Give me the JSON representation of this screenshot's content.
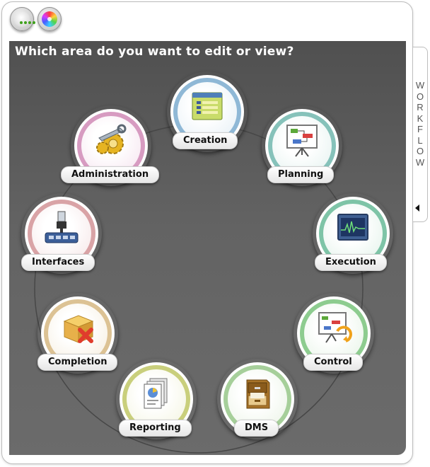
{
  "toolbar": {
    "buttons": [
      {
        "name": "more-options-button",
        "icon": "dots-icon"
      },
      {
        "name": "color-theme-button",
        "icon": "color-wheel-icon"
      }
    ]
  },
  "panel": {
    "heading": "Which area do you want to edit or view?"
  },
  "areas": [
    {
      "label": "Creation",
      "icon": "form-document-icon",
      "color": "#8fb8d6"
    },
    {
      "label": "Planning",
      "icon": "flowchart-board-icon",
      "color": "#86c2ba"
    },
    {
      "label": "Execution",
      "icon": "waveform-monitor-icon",
      "color": "#7ec4a7"
    },
    {
      "label": "Control",
      "icon": "board-refresh-icon",
      "color": "#8dcc8f"
    },
    {
      "label": "DMS",
      "icon": "file-cabinet-icon",
      "color": "#a6cf9a"
    },
    {
      "label": "Reporting",
      "icon": "report-chart-icon",
      "color": "#c9cf7c"
    },
    {
      "label": "Completion",
      "icon": "box-delete-icon",
      "color": "#dcc294"
    },
    {
      "label": "Interfaces",
      "icon": "usb-hub-icon",
      "color": "#d9a3a6"
    },
    {
      "label": "Administration",
      "icon": "gears-wrench-icon",
      "color": "#d79bc1"
    }
  ],
  "sidebar": {
    "title_letters": [
      "W",
      "O",
      "R",
      "K",
      "F",
      "L",
      "O",
      "W"
    ],
    "collapse_icon": "collapse-arrow-icon"
  }
}
